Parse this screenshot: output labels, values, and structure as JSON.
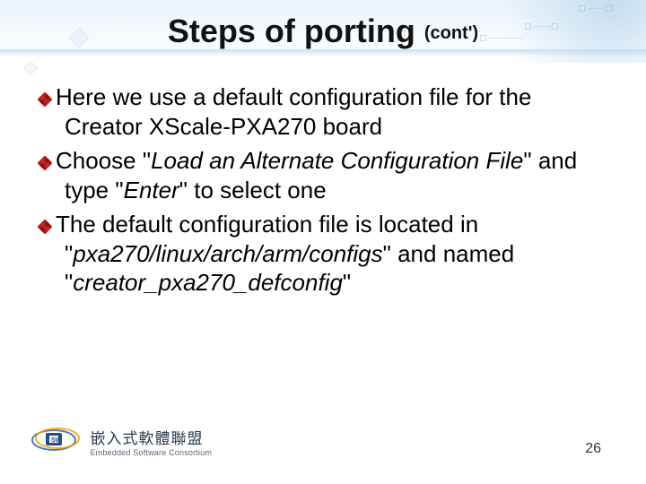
{
  "title": {
    "main": "Steps of porting",
    "cont": "(cont')"
  },
  "bullets": [
    {
      "runs": [
        "Here we use a default configuration file for the Creator XScale-PXA270 board"
      ]
    },
    {
      "runs": [
        "Choose \"",
        "Load an Alternate Configuration File",
        "\" and type \"",
        "Enter",
        "\" to select one"
      ]
    },
    {
      "runs": [
        "The default configuration file is located in \"",
        "pxa270/linux/arch/arm/configs",
        "\" and named \"",
        "creator_pxa270_defconfig",
        "\""
      ]
    }
  ],
  "footer": {
    "zh": "嵌入式軟體聯盟",
    "en": "Embedded Software Consortium"
  },
  "page_number": "26",
  "colors": {
    "bullet": "#b11818"
  }
}
